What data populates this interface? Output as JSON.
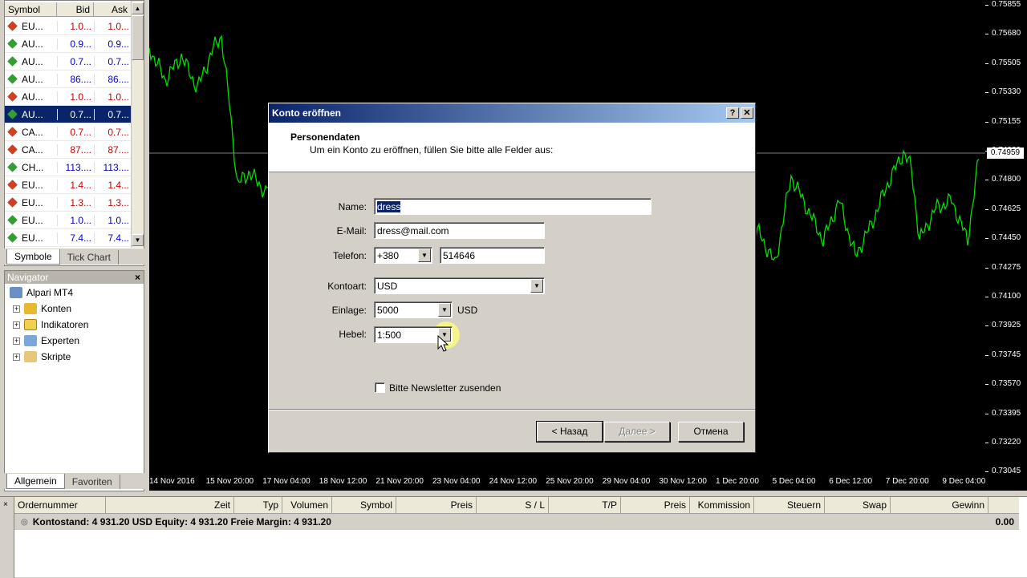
{
  "market_watch": {
    "columns": [
      "Symbol",
      "Bid",
      "Ask"
    ],
    "rows": [
      {
        "symbol": "EU...",
        "bid": "1.0...",
        "ask": "1.0...",
        "dir": "down"
      },
      {
        "symbol": "AU...",
        "bid": "0.9...",
        "ask": "0.9...",
        "dir": "up"
      },
      {
        "symbol": "AU...",
        "bid": "0.7...",
        "ask": "0.7...",
        "dir": "up"
      },
      {
        "symbol": "AU...",
        "bid": "86....",
        "ask": "86....",
        "dir": "up"
      },
      {
        "symbol": "AU...",
        "bid": "1.0...",
        "ask": "1.0...",
        "dir": "down"
      },
      {
        "symbol": "AU...",
        "bid": "0.7...",
        "ask": "0.7...",
        "dir": "up",
        "selected": true
      },
      {
        "symbol": "CA...",
        "bid": "0.7...",
        "ask": "0.7...",
        "dir": "down"
      },
      {
        "symbol": "CA...",
        "bid": "87....",
        "ask": "87....",
        "dir": "down"
      },
      {
        "symbol": "CH...",
        "bid": "113....",
        "ask": "113....",
        "dir": "up"
      },
      {
        "symbol": "EU...",
        "bid": "1.4...",
        "ask": "1.4...",
        "dir": "down"
      },
      {
        "symbol": "EU...",
        "bid": "1.3...",
        "ask": "1.3...",
        "dir": "down"
      },
      {
        "symbol": "EU...",
        "bid": "1.0...",
        "ask": "1.0...",
        "dir": "up"
      },
      {
        "symbol": "EU...",
        "bid": "7.4...",
        "ask": "7.4...",
        "dir": "up"
      }
    ],
    "tabs": [
      "Symbole",
      "Tick Chart"
    ]
  },
  "navigator": {
    "title": "Navigator",
    "root": "Alpari MT4",
    "items": [
      "Konten",
      "Indikatoren",
      "Experten",
      "Skripte"
    ],
    "tabs": [
      "Allgemein",
      "Favoriten"
    ]
  },
  "chart": {
    "price_labels": [
      "0.75855",
      "0.75680",
      "0.75505",
      "0.75330",
      "0.75155",
      "0.74980",
      "0.74800",
      "0.74625",
      "0.74450",
      "0.74275",
      "0.74100",
      "0.73925",
      "0.73745",
      "0.73570",
      "0.73395",
      "0.73220",
      "0.73045"
    ],
    "current_price": "0.74959",
    "time_labels": [
      "14 Nov 2016",
      "15 Nov 20:00",
      "17 Nov 04:00",
      "18 Nov 12:00",
      "21 Nov 20:00",
      "23 Nov 04:00",
      "24 Nov 12:00",
      "25 Nov 20:00",
      "29 Nov 04:00",
      "30 Nov 12:00",
      "1 Dec 20:00",
      "5 Dec 04:00",
      "6 Dec 12:00",
      "7 Dec 20:00",
      "9 Dec 04:00"
    ],
    "line_color": "#00e000"
  },
  "terminal": {
    "columns": [
      "Ordernummer",
      "Zeit",
      "Typ",
      "Volumen",
      "Symbol",
      "Preis",
      "S / L",
      "T/P",
      "Preis",
      "Kommission",
      "Steuern",
      "Swap",
      "Gewinn"
    ],
    "balance_text": "Kontostand: 4 931.20 USD  Equity: 4 931.20  Freie Margin: 4 931.20",
    "total": "0.00"
  },
  "dialog": {
    "title": "Konto eröffnen",
    "help_btn": "?",
    "close_btn": "✕",
    "heading": "Personendaten",
    "subheading": "Um ein Konto zu eröffnen, füllen Sie bitte alle Felder aus:",
    "labels": {
      "name": "Name:",
      "email": "E-Mail:",
      "phone": "Telefon:",
      "account_type": "Kontoart:",
      "deposit": "Einlage:",
      "leverage": "Hebel:"
    },
    "values": {
      "name": "dress",
      "email": "dress@mail.com",
      "phone_code": "+380",
      "phone_number": "514646",
      "account_type": "USD",
      "deposit": "5000",
      "deposit_currency": "USD",
      "leverage": "1:500"
    },
    "newsletter_label": "Bitte Newsletter zusenden",
    "newsletter_checked": false,
    "buttons": {
      "back": "< Назад",
      "next": "Далее >",
      "cancel": "Отмена"
    }
  }
}
